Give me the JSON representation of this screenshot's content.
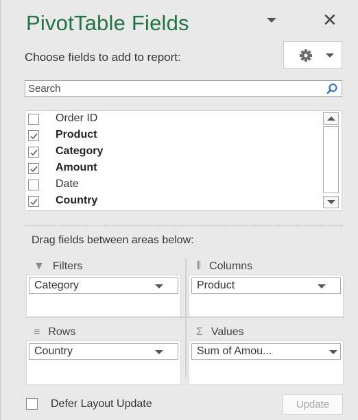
{
  "header": {
    "title": "PivotTable Fields",
    "choose_text": "Choose fields to add to report:",
    "title_dropdown_icon": "chevron-down-icon",
    "close_icon": "close-icon",
    "close_glyph": "✕",
    "tools_icon": "gear-icon"
  },
  "search": {
    "placeholder": "Search",
    "icon": "search-icon"
  },
  "fields": [
    {
      "label": "Order ID",
      "checked": false
    },
    {
      "label": "Product",
      "checked": true
    },
    {
      "label": "Category",
      "checked": true
    },
    {
      "label": "Amount",
      "checked": true
    },
    {
      "label": "Date",
      "checked": false
    },
    {
      "label": "Country",
      "checked": true
    }
  ],
  "areas": {
    "drag_label": "Drag fields between areas below:",
    "filters": {
      "label": "Filters",
      "icon": "filter-icon",
      "glyph": "▼",
      "items": [
        "Category"
      ]
    },
    "columns": {
      "label": "Columns",
      "icon": "columns-icon",
      "glyph": "⦀",
      "items": [
        "Product"
      ]
    },
    "rows": {
      "label": "Rows",
      "icon": "rows-icon",
      "glyph": "≡",
      "items": [
        "Country"
      ]
    },
    "values": {
      "label": "Values",
      "icon": "sigma-icon",
      "glyph": "Σ",
      "items": [
        "Sum of Amou..."
      ]
    }
  },
  "footer": {
    "defer_label": "Defer Layout Update",
    "defer_checked": false,
    "update_label": "Update"
  },
  "colors": {
    "title": "#217346",
    "pane_bg": "#e9e9e9",
    "disabled_text": "#a6a6a6"
  }
}
